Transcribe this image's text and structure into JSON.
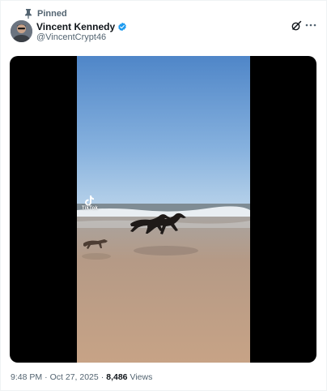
{
  "post": {
    "pinned_label": "Pinned",
    "author": {
      "display_name": "Vincent Kennedy",
      "handle": "@VincentCrypt46"
    },
    "icons": {
      "pin": "pin-icon",
      "verified": "verified-badge-icon",
      "grok": "grok-icon",
      "more": "more-options-icon",
      "tiktok": "tiktok-logo-icon"
    },
    "media": {
      "watermark": "TikTok"
    },
    "meta": {
      "time": "9:48 PM",
      "separator": "·",
      "date": "Oct 27, 2025",
      "views_count": "8,486",
      "views_label": "Views"
    },
    "colors": {
      "verified_blue": "#1d9bf0",
      "secondary_text": "#536471",
      "primary_text": "#0f1419"
    }
  }
}
